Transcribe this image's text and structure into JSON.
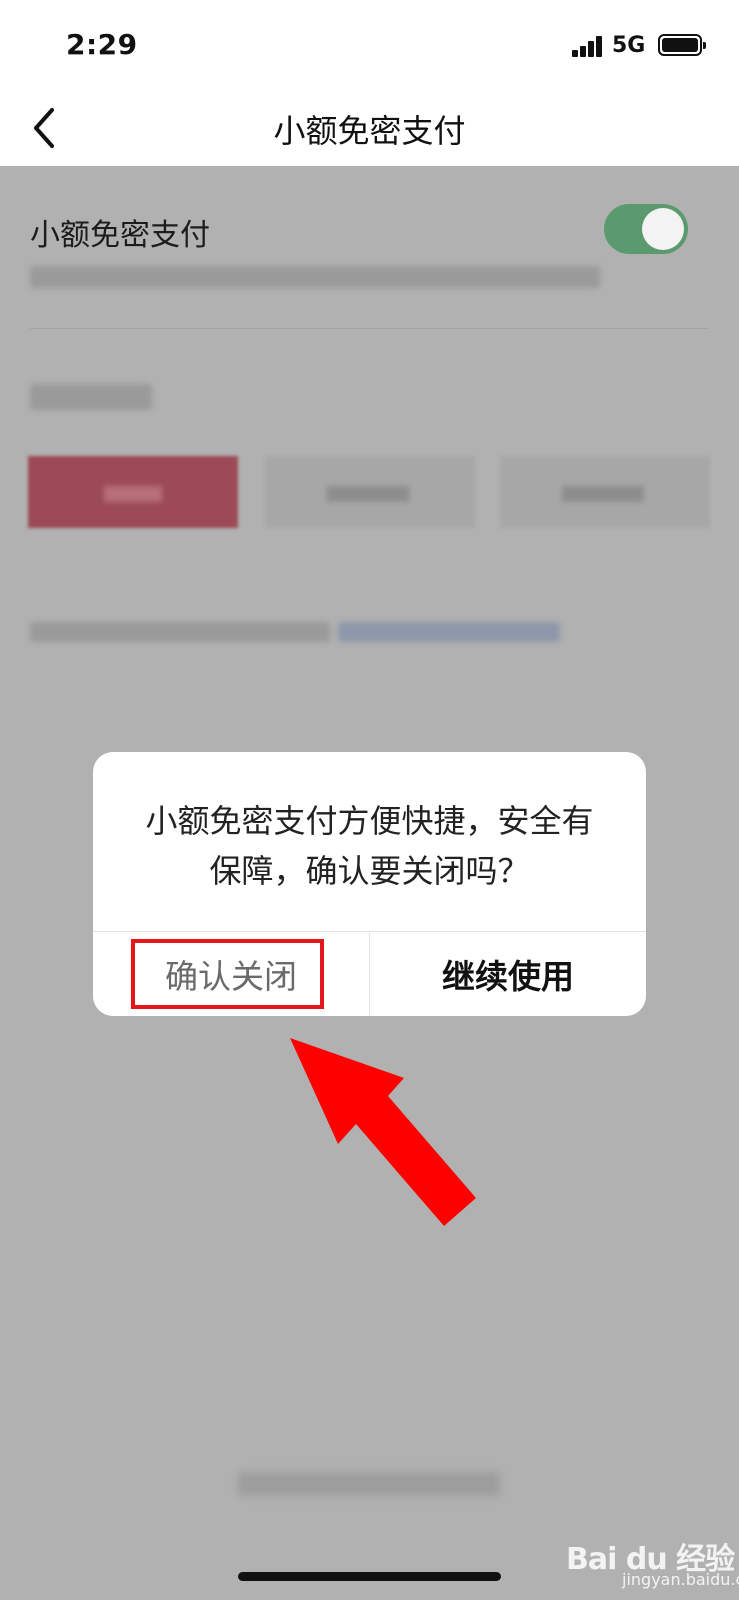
{
  "status_bar": {
    "time": "2:29",
    "network": "5G"
  },
  "nav": {
    "title": "小额免密支付"
  },
  "settings": {
    "row_label": "小额免密支付",
    "toggle_on": true,
    "toggle_color": "#5a9a6e"
  },
  "dialog": {
    "message": "小额免密支付方便快捷，安全有保障，确认要关闭吗？",
    "confirm_label": "确认关闭",
    "continue_label": "继续使用"
  },
  "annotation": {
    "highlight_color": "#e4161c",
    "arrow_color": "#ff0000"
  },
  "watermark": {
    "brand": "Bai du 经验",
    "url": "jingyan.baidu.com"
  }
}
